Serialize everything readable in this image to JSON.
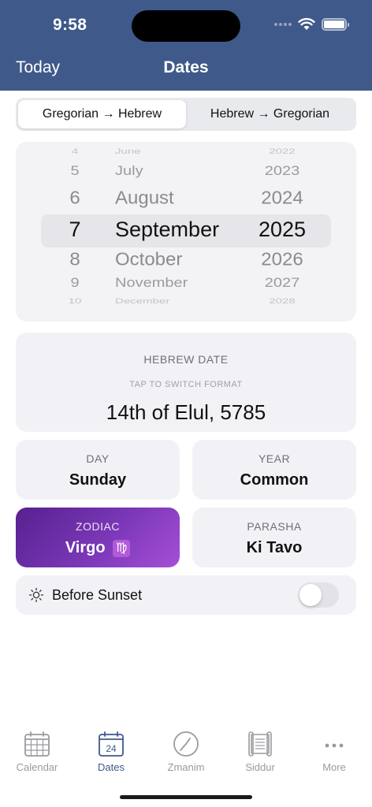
{
  "status": {
    "time": "9:58"
  },
  "nav": {
    "left": "Today",
    "title": "Dates"
  },
  "segments": {
    "gregorian_to_hebrew": "Gregorian → Hebrew",
    "hebrew_to_gregorian": "Hebrew → Gregorian",
    "selected": "gregorian_to_hebrew"
  },
  "picker": {
    "days": [
      "4",
      "5",
      "6",
      "7",
      "8",
      "9",
      "10"
    ],
    "months": [
      "June",
      "July",
      "August",
      "September",
      "October",
      "November",
      "December"
    ],
    "years": [
      "2022",
      "2023",
      "2024",
      "2025",
      "2026",
      "2027",
      "2028"
    ],
    "selected": {
      "day": "7",
      "month": "September",
      "year": "2025"
    }
  },
  "hebrew_date": {
    "label": "HEBREW DATE",
    "hint": "TAP TO SWITCH FORMAT",
    "value": "14th of Elul, 5785"
  },
  "day": {
    "label": "DAY",
    "value": "Sunday"
  },
  "year": {
    "label": "YEAR",
    "value": "Common"
  },
  "zodiac": {
    "label": "ZODIAC",
    "value": "Virgo",
    "symbol": "♍"
  },
  "parasha": {
    "label": "PARASHA",
    "value": "Ki Tavo"
  },
  "sunset": {
    "label": "Before Sunset",
    "enabled": false
  },
  "tabs": [
    {
      "label": "Calendar",
      "icon": "calendar-grid-icon"
    },
    {
      "label": "Dates",
      "icon": "calendar-day-icon",
      "badge": "24",
      "active": true
    },
    {
      "label": "Zmanim",
      "icon": "clock-icon"
    },
    {
      "label": "Siddur",
      "icon": "scroll-icon"
    },
    {
      "label": "More",
      "icon": "ellipsis-icon"
    }
  ],
  "colors": {
    "header": "#3f5a8a",
    "accent": "#3f5a8a",
    "zodiac_gradient_start": "#57208f",
    "zodiac_gradient_end": "#a64fd6"
  }
}
